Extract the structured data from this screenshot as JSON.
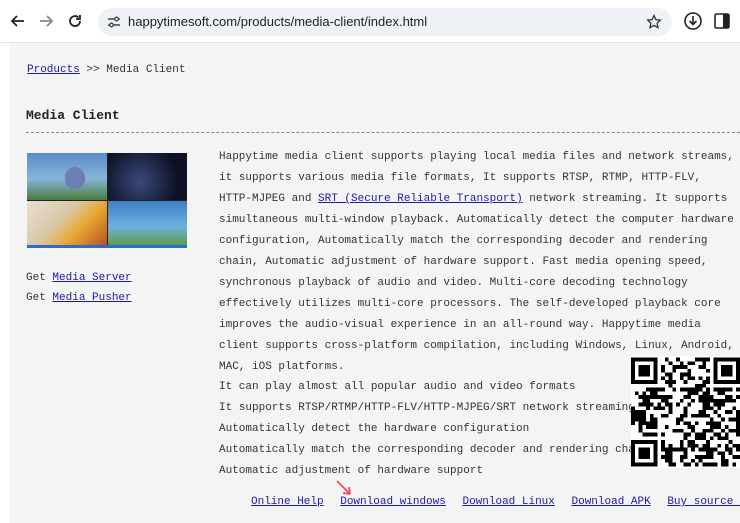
{
  "browser": {
    "url": "happytimesoft.com/products/media-client/index.html",
    "icons": {
      "back": "back-arrow-icon",
      "forward": "forward-arrow-icon",
      "reload": "reload-icon",
      "site_info": "tune-icon",
      "bookmark": "star-icon",
      "downloads": "download-icon",
      "side_panel": "side-panel-icon"
    }
  },
  "breadcrumb": {
    "root": "Products",
    "separator": ">>",
    "current": "Media Client"
  },
  "page_title": "Media Client",
  "side_links": [
    {
      "prefix": "Get",
      "label": "Media Server"
    },
    {
      "prefix": "Get",
      "label": "Media Pusher"
    }
  ],
  "description": {
    "part1": "Happytime media client supports playing local media files and network streams, it supports various media file formats, It supports RTSP, RTMP, HTTP-FLV, HTTP-MJPEG and ",
    "srt_link": "SRT (Secure Reliable Transport)",
    "part2": " network streaming. It supports simultaneous multi-window playback. Automatically detect the computer hardware configuration, Automatically match the corresponding decoder and rendering chain, Automatic adjustment of hardware support. Fast media opening speed, synchronous playback of audio and video. Multi-core decoding technology effectively utilizes multi-core processors. The self-developed playback core improves the audio-visual experience in an all-round way. Happytime media client supports cross-platform compilation, including Windows, Linux, Android, MAC, iOS platforms."
  },
  "features": [
    "It can play almost all popular audio and video formats",
    "It supports RTSP/RTMP/HTTP-FLV/HTTP-MJPEG/SRT network streaming",
    "Automatically detect the hardware configuration",
    "Automatically match the corresponding decoder and rendering chain",
    "Automatic adjustment of hardware support"
  ],
  "footer_links": [
    "Online Help",
    "Download windows",
    "Download Linux",
    "Download APK",
    "Buy source code"
  ],
  "colors": {
    "link": "#1a1aa8",
    "page_bg": "#f4f4f4",
    "annotation_arrow": "#e8505b"
  }
}
